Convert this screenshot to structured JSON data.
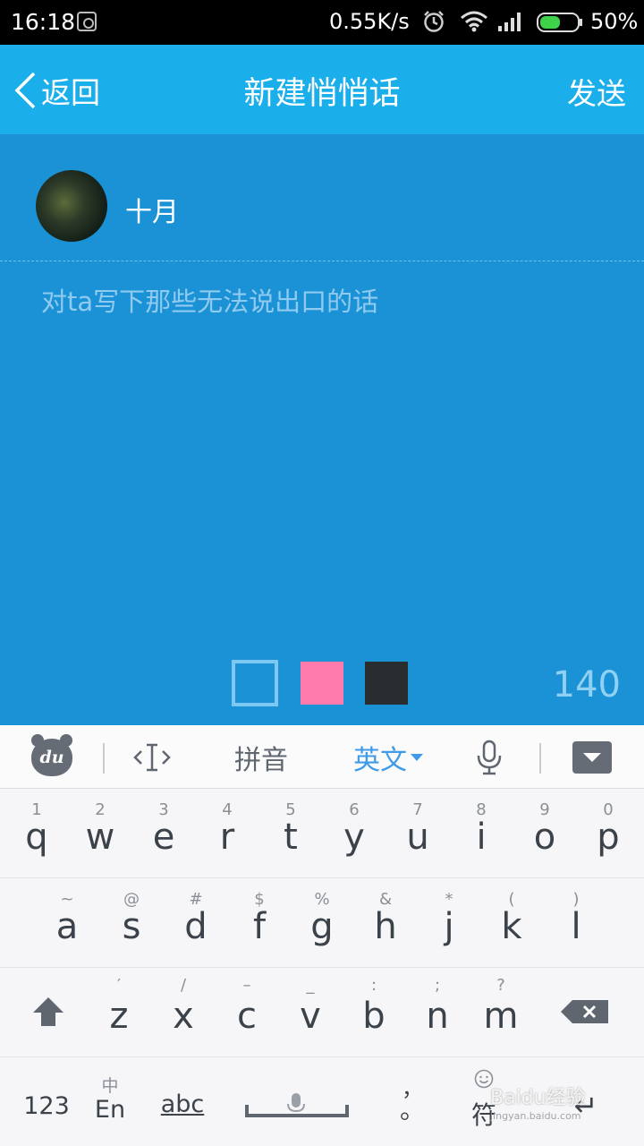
{
  "status_bar": {
    "time": "16:18",
    "speed": "0.55K/s",
    "battery": "50%"
  },
  "header": {
    "back_label": "返回",
    "title": "新建悄悄话",
    "send_label": "发送"
  },
  "compose": {
    "recipient_name": "十月",
    "placeholder": "对ta写下那些无法说出口的话",
    "char_count": "140",
    "swatch_colors": [
      "#1b92d5",
      "#ff7bab",
      "#2a2d30"
    ]
  },
  "keyboard": {
    "toolbar": {
      "pinyin": "拼音",
      "english": "英文"
    },
    "row1": [
      {
        "pri": "q",
        "sec": "1"
      },
      {
        "pri": "w",
        "sec": "2"
      },
      {
        "pri": "e",
        "sec": "3"
      },
      {
        "pri": "r",
        "sec": "4"
      },
      {
        "pri": "t",
        "sec": "5"
      },
      {
        "pri": "y",
        "sec": "6"
      },
      {
        "pri": "u",
        "sec": "7"
      },
      {
        "pri": "i",
        "sec": "8"
      },
      {
        "pri": "o",
        "sec": "9"
      },
      {
        "pri": "p",
        "sec": "0"
      }
    ],
    "row2": [
      {
        "pri": "a",
        "sec": "~"
      },
      {
        "pri": "s",
        "sec": "@"
      },
      {
        "pri": "d",
        "sec": "#"
      },
      {
        "pri": "f",
        "sec": "$"
      },
      {
        "pri": "g",
        "sec": "%"
      },
      {
        "pri": "h",
        "sec": "&"
      },
      {
        "pri": "j",
        "sec": "*"
      },
      {
        "pri": "k",
        "sec": "("
      },
      {
        "pri": "l",
        "sec": ")"
      }
    ],
    "row3": [
      {
        "pri": "z",
        "sec": "′"
      },
      {
        "pri": "x",
        "sec": "/"
      },
      {
        "pri": "c",
        "sec": "–"
      },
      {
        "pri": "v",
        "sec": "_"
      },
      {
        "pri": "b",
        "sec": ":"
      },
      {
        "pri": "n",
        "sec": ";"
      },
      {
        "pri": "m",
        "sec": "?"
      }
    ],
    "row4": {
      "num": "123",
      "lang_top": "中",
      "lang": "En",
      "abc": "abc",
      "comma": "，",
      "period": "。",
      "symbol": "符",
      "enter": "↵"
    }
  },
  "watermark": {
    "main": "Baidu经验",
    "sub": "jingyan.baidu.com"
  }
}
